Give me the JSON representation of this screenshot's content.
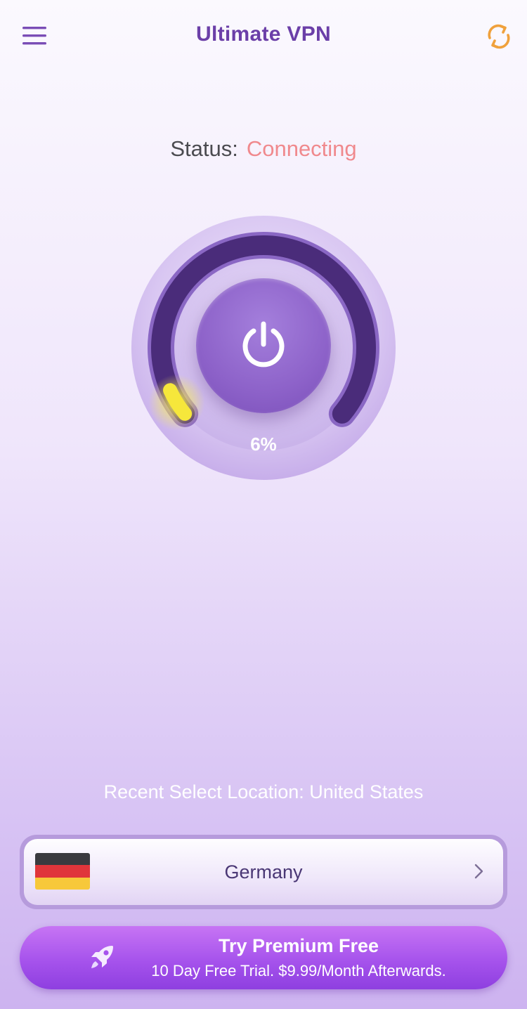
{
  "header": {
    "title": "Ultimate VPN",
    "menu_icon": "hamburger-menu-icon",
    "refresh_icon": "refresh-icon",
    "refresh_color": "#f0a13c"
  },
  "status": {
    "label": "Status:",
    "value": "Connecting",
    "value_color": "#f0898d"
  },
  "connection": {
    "progress_percent": 6,
    "progress_label": "6%",
    "power_icon": "power-icon"
  },
  "location": {
    "recent_label": "Recent Select Location: United States",
    "selected_country": "Germany",
    "flag_icon": "germany-flag-icon",
    "flag_colors": [
      "#3a3a3f",
      "#e0353b",
      "#f7c83a"
    ],
    "chevron_icon": "chevron-right-icon"
  },
  "premium": {
    "title": "Try Premium Free",
    "subtitle": "10 Day Free Trial. $9.99/Month Afterwards.",
    "icon": "rocket-icon"
  },
  "colors": {
    "brand_purple": "#6b3fa8",
    "dial_track": "#4a2c7a",
    "progress_glow": "#f3e33a"
  }
}
